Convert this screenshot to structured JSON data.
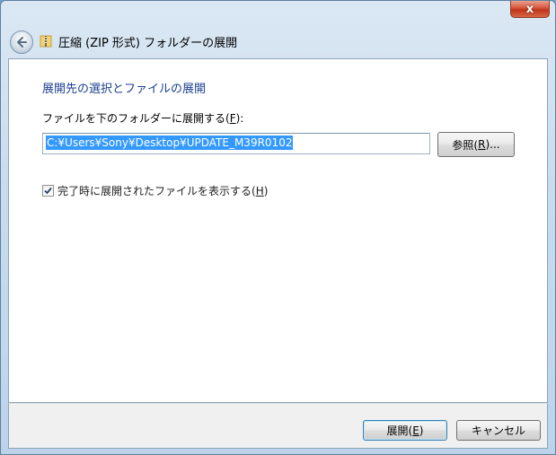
{
  "window": {
    "title": "圧縮 (ZIP 形式) フォルダーの展開",
    "close_symbol": "x"
  },
  "content": {
    "heading": "展開先の選択とファイルの展開",
    "dest_label_prefix": "ファイルを下のフォルダーに展開する(",
    "dest_label_key": "F",
    "dest_label_suffix": "):",
    "path_value": "C:¥Users¥Sony¥Desktop¥UPDATE_M39R0102",
    "browse_prefix": "参照(",
    "browse_key": "R",
    "browse_suffix": ")...",
    "checkbox_prefix": "完了時に展開されたファイルを表示する(",
    "checkbox_key": "H",
    "checkbox_suffix": ")",
    "checkbox_checked": true
  },
  "footer": {
    "extract_prefix": "展開(",
    "extract_key": "E",
    "extract_suffix": ")",
    "cancel_label": "キャンセル"
  },
  "icons": {
    "back": "back-arrow-icon",
    "folder": "zip-folder-icon",
    "check": "checkmark-icon"
  }
}
